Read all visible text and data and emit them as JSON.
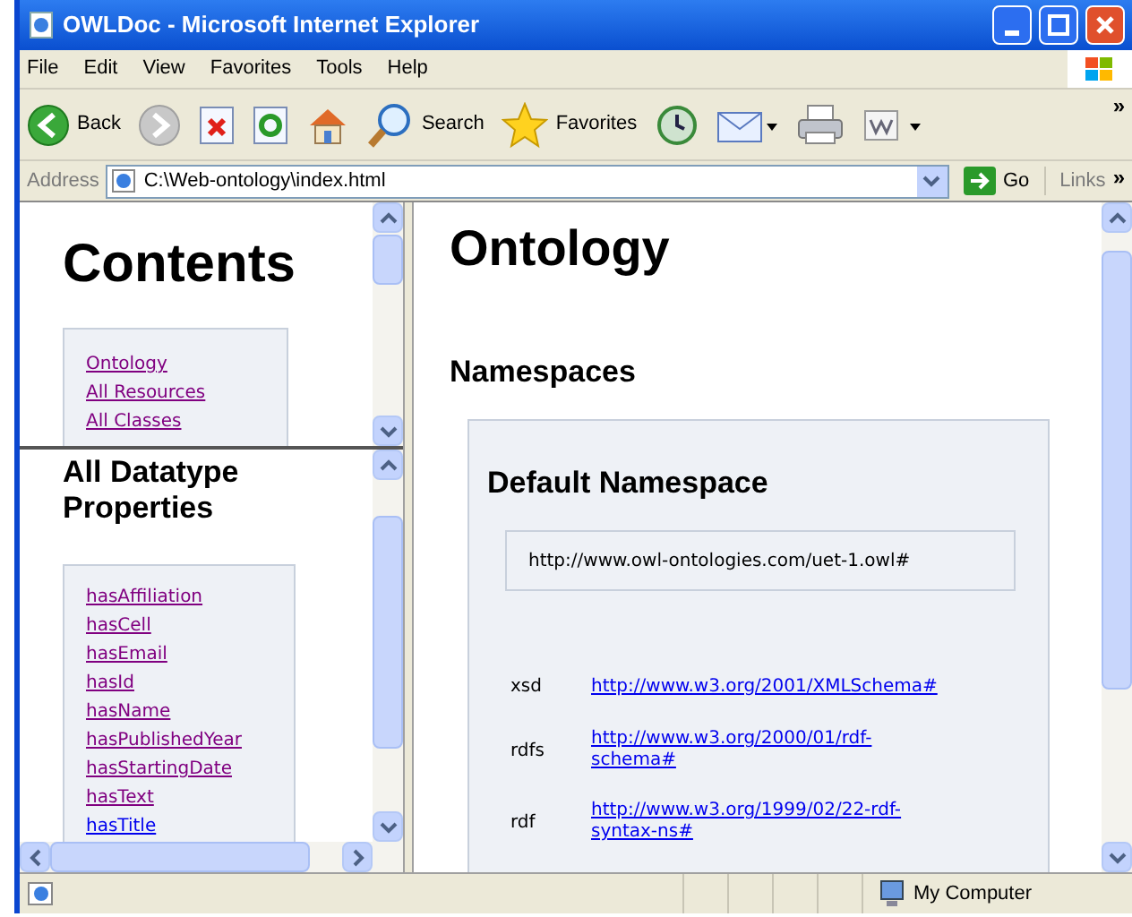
{
  "window": {
    "title": "OWLDoc - Microsoft Internet Explorer"
  },
  "menu": [
    "File",
    "Edit",
    "View",
    "Favorites",
    "Tools",
    "Help"
  ],
  "toolbar": [
    {
      "kind": "back",
      "label": "Back"
    },
    {
      "kind": "forward"
    },
    {
      "kind": "stop"
    },
    {
      "kind": "refresh"
    },
    {
      "kind": "home"
    },
    {
      "kind": "search",
      "label": "Search"
    },
    {
      "kind": "favorites",
      "label": "Favorites"
    },
    {
      "kind": "history"
    },
    {
      "kind": "mail"
    },
    {
      "kind": "print"
    },
    {
      "kind": "edit"
    }
  ],
  "toolbar_more": "»",
  "address": {
    "label": "Address",
    "value": "C:\\Web-ontology\\index.html",
    "go": "Go",
    "links": "Links",
    "more": "»"
  },
  "contents_frame": {
    "heading": "Contents",
    "links": [
      {
        "text": "Ontology",
        "visited": true
      },
      {
        "text": "All Resources",
        "visited": true
      },
      {
        "text": "All Classes",
        "visited": true
      }
    ]
  },
  "properties_frame": {
    "heading": "All Datatype Properties",
    "links": [
      {
        "text": "hasAffiliation",
        "visited": true
      },
      {
        "text": "hasCell",
        "visited": true
      },
      {
        "text": "hasEmail",
        "visited": true
      },
      {
        "text": "hasId",
        "visited": true
      },
      {
        "text": "hasName",
        "visited": true
      },
      {
        "text": "hasPublishedYear",
        "visited": true
      },
      {
        "text": "hasStartingDate",
        "visited": true
      },
      {
        "text": "hasText",
        "visited": true
      },
      {
        "text": "hasTitle",
        "visited": false
      }
    ]
  },
  "main_frame": {
    "heading": "Ontology",
    "section": "Namespaces",
    "default_namespace": {
      "heading": "Default Namespace",
      "uri": "http://www.owl-ontologies.com/uet-1.owl#"
    },
    "namespaces": [
      {
        "prefix": "xsd",
        "uri": "http://www.w3.org/2001/XMLSchema#",
        "visited": false
      },
      {
        "prefix": "rdfs",
        "uri": "http://www.w3.org/2000/01/rdf-schema#",
        "visited": false
      },
      {
        "prefix": "rdf",
        "uri": "http://www.w3.org/1999/02/22-rdf-syntax-ns#",
        "visited": false
      }
    ]
  },
  "status_bar": {
    "zone": "My Computer"
  }
}
